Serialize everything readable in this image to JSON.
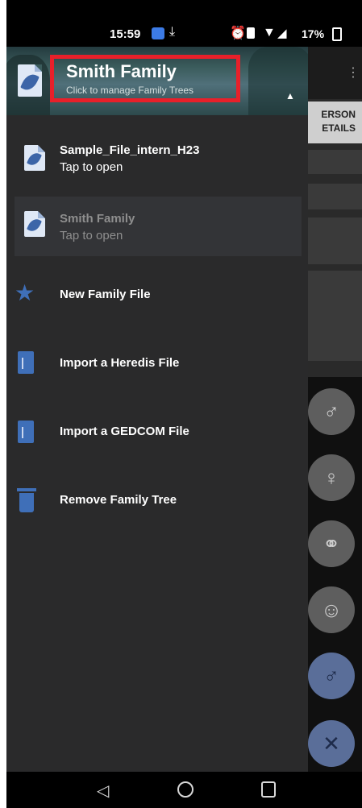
{
  "status_bar": {
    "time": "15:59",
    "battery": "17%"
  },
  "drawer": {
    "header": {
      "title": "Smith Family",
      "subtitle": "Click to manage Family Trees"
    },
    "files": [
      {
        "name": "Sample_File_intern_H23",
        "subtitle": "Tap to open",
        "selected": false
      },
      {
        "name": "Smith Family",
        "subtitle": "Tap to open",
        "selected": true
      }
    ],
    "actions": [
      {
        "label": "New Family File",
        "icon": "star-icon"
      },
      {
        "label": "Import a Heredis File",
        "icon": "heredis-file-icon"
      },
      {
        "label": "Import a GEDCOM File",
        "icon": "gedcom-file-icon"
      },
      {
        "label": "Remove Family Tree",
        "icon": "trash-icon"
      }
    ]
  },
  "background_app": {
    "tab_label_line1": "ERSON",
    "tab_label_line2": "ETAILS",
    "fab_icons": [
      "man-icon",
      "woman-icon",
      "couple-icon",
      "child-icon",
      "person-add-icon",
      "close-icon"
    ]
  },
  "colors": {
    "accent": "#3f6fb8",
    "highlight_box": "#e8202a",
    "drawer_bg": "#2a2a2b"
  }
}
